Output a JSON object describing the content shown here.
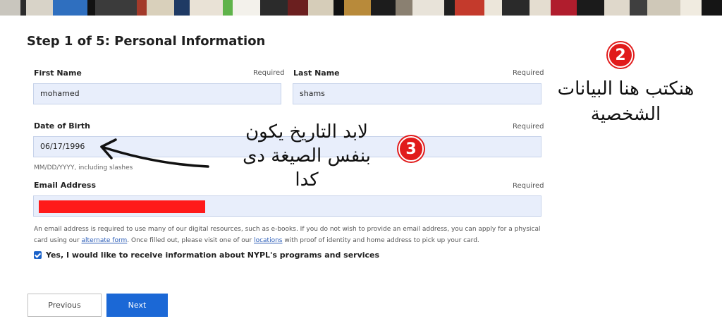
{
  "form": {
    "step_title": "Step 1 of 5: Personal Information",
    "first_name": {
      "label": "First Name",
      "required": "Required",
      "value": "mohamed"
    },
    "last_name": {
      "label": "Last Name",
      "required": "Required",
      "value": "shams"
    },
    "dob": {
      "label": "Date of Birth",
      "required": "Required",
      "value": "06/17/1996",
      "hint": "MM/DD/YYYY, including slashes"
    },
    "email": {
      "label": "Email Address",
      "required": "Required",
      "value": ""
    },
    "email_note": {
      "part1": "An email address is required to use many of our digital resources, such as e-books. If you do not wish to provide an email address, you can apply for a physical card using our ",
      "link1": "alternate form",
      "part2": ". Once filled out, please visit one of our ",
      "link2": "locations",
      "part3": " with proof of identity and home address to pick up your card."
    },
    "consent_label": "Yes, I would like to receive information about NYPL's programs and services",
    "consent_checked": true,
    "previous_label": "Previous",
    "next_label": "Next"
  },
  "annotations": {
    "badge2": "2",
    "text2_line1": "هنكتب هنا البيانات",
    "text2_line2": "الشخصية",
    "badge3": "3",
    "text3_line1": "لابد التاريخ يكون",
    "text3_line2": "بنفس الصيغة دى",
    "text3_line3": "كدا"
  },
  "colors": {
    "accent": "#1b68d6",
    "input_bg": "#e8eefb",
    "badge": "#e11b1b",
    "redaction": "#ff1a1a"
  }
}
